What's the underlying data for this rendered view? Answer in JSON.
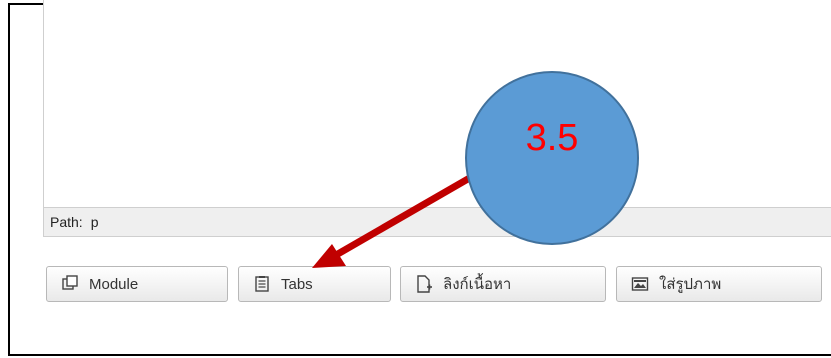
{
  "editor": {
    "path_label": "Path:",
    "path_value": "p"
  },
  "buttons": [
    {
      "label": "Module",
      "icon": "module-icon"
    },
    {
      "label": "Tabs",
      "icon": "tabs-icon"
    },
    {
      "label": "ลิงก์เนื้อหา",
      "icon": "link-content-icon"
    },
    {
      "label": "ใส่รูปภาพ",
      "icon": "image-icon"
    }
  ],
  "annotation": {
    "step_label": "3.5",
    "circle_color": "#5b9bd5",
    "label_color": "#ff0000",
    "arrow_color": "#c00000"
  }
}
